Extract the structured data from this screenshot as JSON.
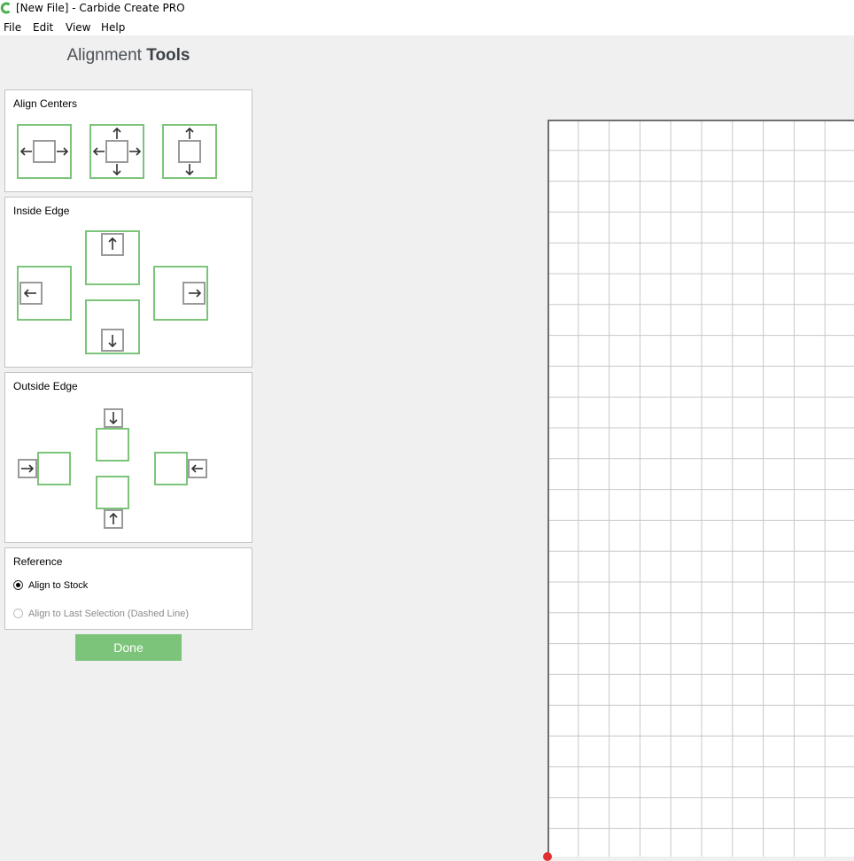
{
  "window": {
    "title": "[New File] - Carbide Create PRO",
    "logo_icon": "carbide-logo-icon",
    "accent_color": "#4caf50"
  },
  "menu": [
    "File",
    "Edit",
    "View",
    "Help"
  ],
  "panel": {
    "title_light": "Alignment",
    "title_bold": "Tools"
  },
  "groups": {
    "align_centers": {
      "title": "Align Centers",
      "buttons": [
        "align-center-horizontal-icon",
        "align-center-both-icon",
        "align-center-vertical-icon"
      ]
    },
    "inside_edge": {
      "title": "Inside Edge",
      "buttons": [
        "align-inside-top-icon",
        "align-inside-left-icon",
        "align-inside-right-icon",
        "align-inside-bottom-icon"
      ]
    },
    "outside_edge": {
      "title": "Outside Edge",
      "buttons": [
        "align-outside-top-icon",
        "align-outside-left-icon",
        "align-outside-right-icon",
        "align-outside-bottom-icon"
      ]
    },
    "reference": {
      "title": "Reference",
      "options": [
        {
          "label": "Align to Stock",
          "checked": true,
          "enabled": true
        },
        {
          "label": "Align to Last Selection (Dashed Line)",
          "checked": false,
          "enabled": false
        }
      ]
    }
  },
  "done_label": "Done",
  "colors": {
    "button_green": "#7dc47b",
    "frame_green": "#7dc47b",
    "grid_line": "#c8c8c8",
    "canvas_border": "#707070",
    "origin_red": "#e23030"
  }
}
